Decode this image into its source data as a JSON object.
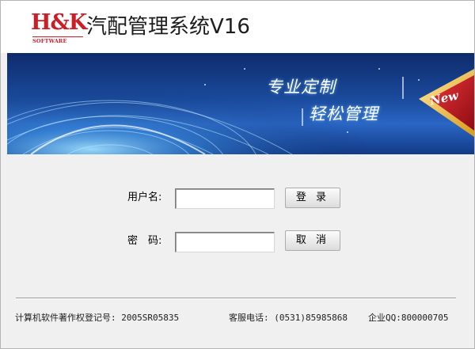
{
  "header": {
    "logo_text": "H&K",
    "logo_sub": "SOFTWARE",
    "app_title": "汽配管理系统V16"
  },
  "banner": {
    "slogan_line1": "专业定制",
    "slogan_line2": "轻松管理",
    "badge": "New"
  },
  "form": {
    "username_label": "用户名:",
    "username_value": "",
    "password_label": "密　码:",
    "password_value": "",
    "login_button": "登 录",
    "cancel_button": "取 消"
  },
  "footer": {
    "copyright": "计算机软件著作权登记号: 2005SR05835",
    "phone": "客服电话: (0531)85985868",
    "qq": "企业QQ:800000705"
  },
  "colors": {
    "brand_red": "#cc1e26",
    "banner_blue": "#1a4a9c",
    "window_bg": "#f0f0f0"
  }
}
